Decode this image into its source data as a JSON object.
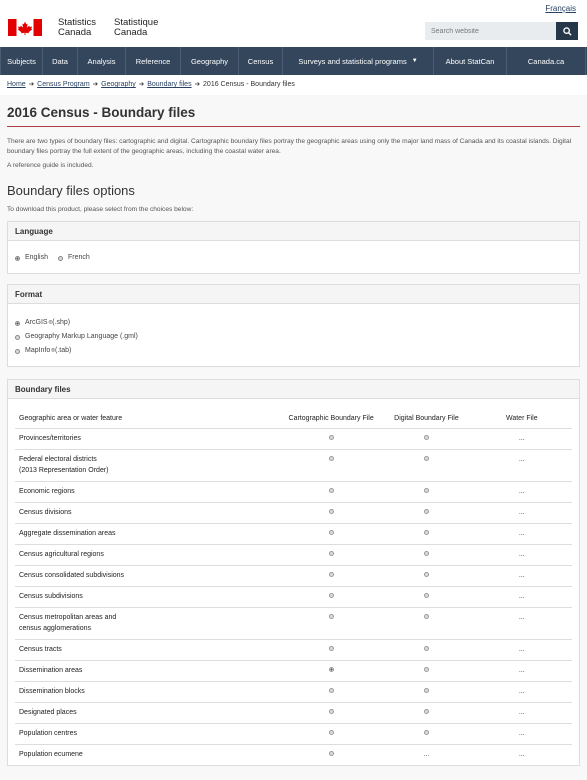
{
  "header": {
    "signature_en": [
      "Statistics",
      "Canada"
    ],
    "signature_fr": [
      "Statistique",
      "Canada"
    ],
    "lang_link": "Français",
    "search_placeholder": "Search website",
    "flag_color": "#e30000"
  },
  "menu": [
    {
      "label": "Subjects"
    },
    {
      "label": "Data"
    },
    {
      "label": "Analysis"
    },
    {
      "label": "Reference"
    },
    {
      "label": "Geography"
    },
    {
      "label": "Census"
    },
    {
      "label": "Surveys and statistical programs",
      "has_caret": true
    },
    {
      "label": "About StatCan"
    },
    {
      "label": "Canada.ca"
    }
  ],
  "breadcrumb": [
    {
      "label": "Home",
      "link": true
    },
    {
      "label": "Census Program",
      "link": true
    },
    {
      "label": "Geography",
      "link": true
    },
    {
      "label": "Boundary files",
      "link": true
    },
    {
      "label": "2016 Census - Boundary files",
      "link": false
    }
  ],
  "page": {
    "title": "2016 Census - Boundary files",
    "intro": "There are two types of boundary files: cartographic and digital. Cartographic boundary files portray the geographic areas using only the major land mass of Canada and its coastal islands. Digital boundary files portray the full extent of the geographic areas, including the coastal water area.",
    "reference_note": "A reference guide is included.",
    "options_heading": "Boundary files options",
    "instructions": "To download this product, please select from the choices below:"
  },
  "language_panel": {
    "heading": "Language",
    "options": [
      {
        "label": "English",
        "checked": true
      },
      {
        "label": "French",
        "checked": false
      }
    ]
  },
  "format_panel": {
    "heading": "Format",
    "options": [
      {
        "label": "ArcGIS",
        "sup": "®",
        "suffix": " (.shp)",
        "checked": true
      },
      {
        "label": "Geography Markup Language (.gml)",
        "sup": "",
        "suffix": "",
        "checked": false
      },
      {
        "label": "MapInfo",
        "sup": "®",
        "suffix": " (.tab)",
        "checked": false
      }
    ]
  },
  "boundary_panel": {
    "heading": "Boundary files",
    "columns": {
      "area": "Geographic area or water feature",
      "cartographic": "Cartographic Boundary File",
      "digital": "Digital Boundary File",
      "water": "Water File"
    },
    "rows": [
      {
        "area": "Provinces/territories",
        "carto": "radio",
        "digital": "radio",
        "water": "..."
      },
      {
        "area": "Federal electoral districts (2013 Representation Order)",
        "carto": "radio",
        "digital": "radio",
        "water": "..."
      },
      {
        "area": "Economic regions",
        "carto": "radio",
        "digital": "radio",
        "water": "..."
      },
      {
        "area": "Census divisions",
        "carto": "radio",
        "digital": "radio",
        "water": "..."
      },
      {
        "area": "Aggregate dissemination areas",
        "carto": "radio",
        "digital": "radio",
        "water": "..."
      },
      {
        "area": "Census agricultural regions",
        "carto": "radio",
        "digital": "radio",
        "water": "..."
      },
      {
        "area": "Census consolidated subdivisions",
        "carto": "radio",
        "digital": "radio",
        "water": "..."
      },
      {
        "area": "Census subdivisions",
        "carto": "radio",
        "digital": "radio",
        "water": "..."
      },
      {
        "area": "Census metropolitan areas and census agglomerations",
        "carto": "radio",
        "digital": "radio",
        "water": "..."
      },
      {
        "area": "Census tracts",
        "carto": "radio",
        "digital": "radio",
        "water": "..."
      },
      {
        "area": "Dissemination areas",
        "carto": "radio-checked",
        "digital": "radio",
        "water": "..."
      },
      {
        "area": "Dissemination blocks",
        "carto": "radio",
        "digital": "radio",
        "water": "..."
      },
      {
        "area": "Designated places",
        "carto": "radio",
        "digital": "radio",
        "water": "..."
      },
      {
        "area": "Population centres",
        "carto": "radio",
        "digital": "radio",
        "water": "..."
      },
      {
        "area": "Population ecumene",
        "carto": "radio",
        "digital": "...",
        "water": "..."
      }
    ]
  }
}
